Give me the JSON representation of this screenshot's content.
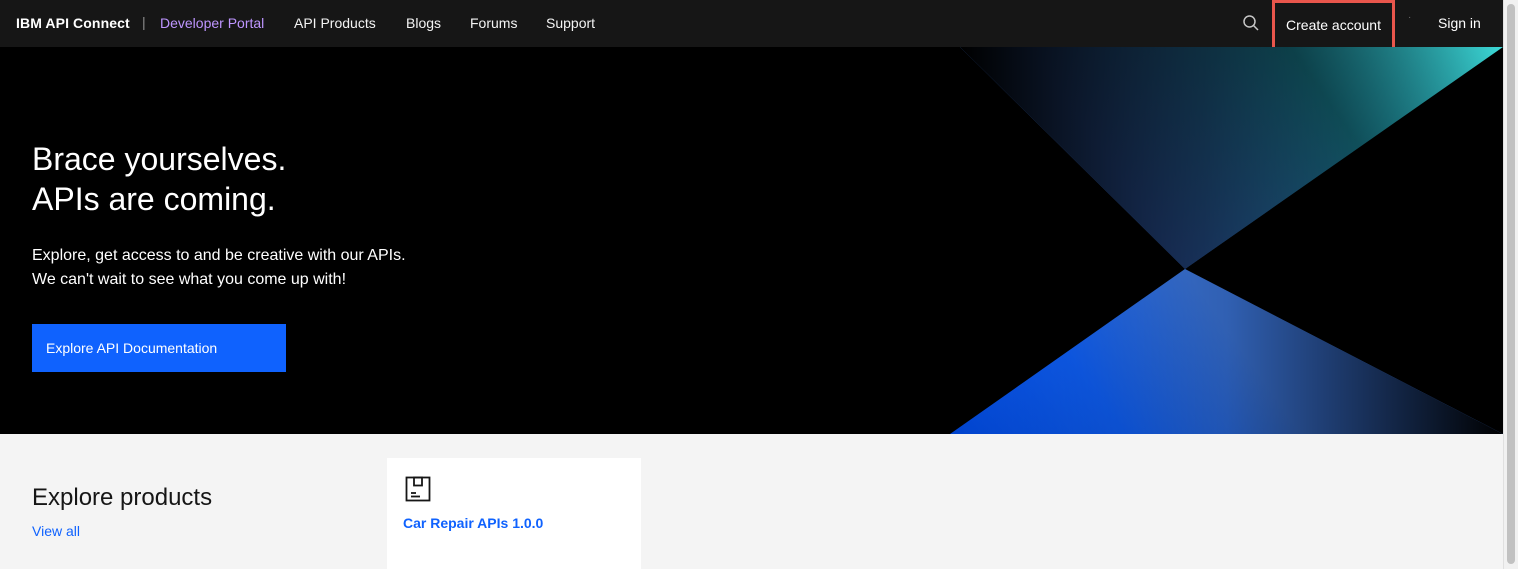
{
  "header": {
    "brand": "IBM API Connect",
    "separator": "|",
    "portal_label": "Developer Portal",
    "nav": [
      "API Products",
      "Blogs",
      "Forums",
      "Support"
    ],
    "search_icon": "search-icon",
    "create_account": "Create account",
    "dot": "·",
    "sign_in": "Sign in"
  },
  "hero": {
    "headline_line1": "Brace yourselves.",
    "headline_line2": "APIs are coming.",
    "sub_line1": "Explore, get access to and be creative with our APIs.",
    "sub_line2": "We can't wait to see what you come up with!",
    "cta_label": "Explore API Documentation"
  },
  "products": {
    "title": "Explore products",
    "view_all": "View all",
    "cards": [
      {
        "title": "Car Repair APIs 1.0.0",
        "icon": "product-icon"
      }
    ]
  },
  "colors": {
    "nav_bg": "#161616",
    "portal_accent": "#be95ff",
    "primary": "#0f62fe",
    "highlight_border": "#e8564c",
    "teal": "#3ddbd9"
  }
}
